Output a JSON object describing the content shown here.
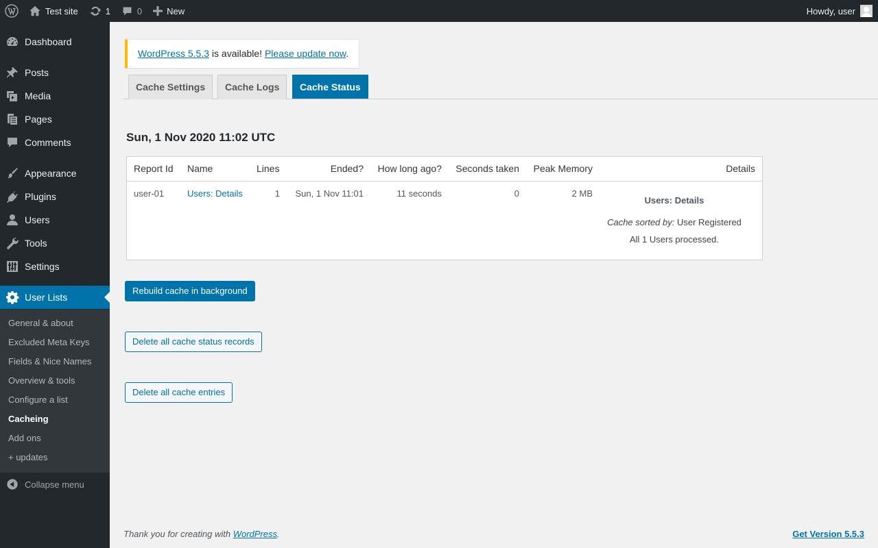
{
  "adminbar": {
    "site_name": "Test site",
    "updates_count": "1",
    "comments_count": "0",
    "new_label": "New",
    "greeting": "Howdy, user"
  },
  "sidebar": {
    "items": [
      {
        "label": "Dashboard",
        "icon": "dashboard-icon"
      },
      {
        "label": "Posts",
        "icon": "pushpin-icon"
      },
      {
        "label": "Media",
        "icon": "media-icon"
      },
      {
        "label": "Pages",
        "icon": "pages-icon"
      },
      {
        "label": "Comments",
        "icon": "comment-icon"
      },
      {
        "label": "Appearance",
        "icon": "paintbrush-icon"
      },
      {
        "label": "Plugins",
        "icon": "plug-icon"
      },
      {
        "label": "Users",
        "icon": "user-icon"
      },
      {
        "label": "Tools",
        "icon": "wrench-icon"
      },
      {
        "label": "Settings",
        "icon": "sliders-icon"
      },
      {
        "label": "User Lists",
        "icon": "gear-icon"
      }
    ],
    "submenu": [
      "General & about",
      "Excluded Meta Keys",
      "Fields & Nice Names",
      "Overview & tools",
      "Configure a list",
      "Cacheing",
      "Add ons",
      "+ updates"
    ],
    "collapse_label": "Collapse menu"
  },
  "notice": {
    "link_version": "WordPress 5.5.3",
    "middle": " is available! ",
    "link_update": "Please update now",
    "end": "."
  },
  "tabs": [
    "Cache Settings",
    "Cache Logs",
    "Cache Status"
  ],
  "timestamp": "Sun, 1 Nov 2020 11:02 UTC",
  "table": {
    "headers": [
      "Report Id",
      "Name",
      "Lines",
      "Ended?",
      "How long ago?",
      "Seconds taken",
      "Peak Memory",
      "Details"
    ],
    "row": {
      "report_id": "user-01",
      "name": "Users: Details",
      "lines": "1",
      "ended": "Sun, 1 Nov 11:01",
      "how_long": "11 seconds",
      "seconds": "0",
      "memory": "2 MB",
      "details_title": "Users: Details",
      "sorted_by_label": "Cache sorted by:",
      "sorted_by_value": " User Registered",
      "processed": "All 1 Users processed."
    }
  },
  "buttons": {
    "rebuild": "Rebuild cache in background",
    "delete_status": "Delete all cache status records",
    "delete_entries": "Delete all cache entries"
  },
  "footer": {
    "thanks": "Thank you for creating with ",
    "wp_link": "WordPress",
    "period": ".",
    "version": "Get Version 5.5.3"
  }
}
